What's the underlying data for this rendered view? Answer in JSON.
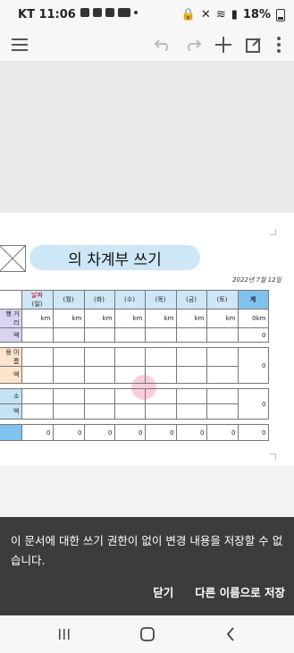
{
  "status": {
    "time": "KT 11:06",
    "battery": "18%"
  },
  "document": {
    "title": "의 차계부 쓰기",
    "date": "2022년 7월 12일",
    "date_label": "날짜",
    "total_label": "계",
    "days": [
      "(일)",
      "(월)",
      "(화)",
      "(수)",
      "(목)",
      "(금)",
      "(토)"
    ],
    "row_labels": {
      "distance": "행 거리",
      "amount1": "액",
      "usage": "용 이름",
      "amount2": "액",
      "small": "소",
      "amount3": "액"
    },
    "km_unit": "km",
    "total_km": "0km",
    "zeros": [
      "0",
      "0",
      "0",
      "0",
      "0",
      "0",
      "0",
      "0"
    ],
    "zero": "0"
  },
  "snackbar": {
    "message": "이 문서에 대한 쓰기 권한이 없이 변경 내용을 저장할 수 없습니다.",
    "close_label": "닫기",
    "save_as_label": "다른 이름으로 저장"
  }
}
